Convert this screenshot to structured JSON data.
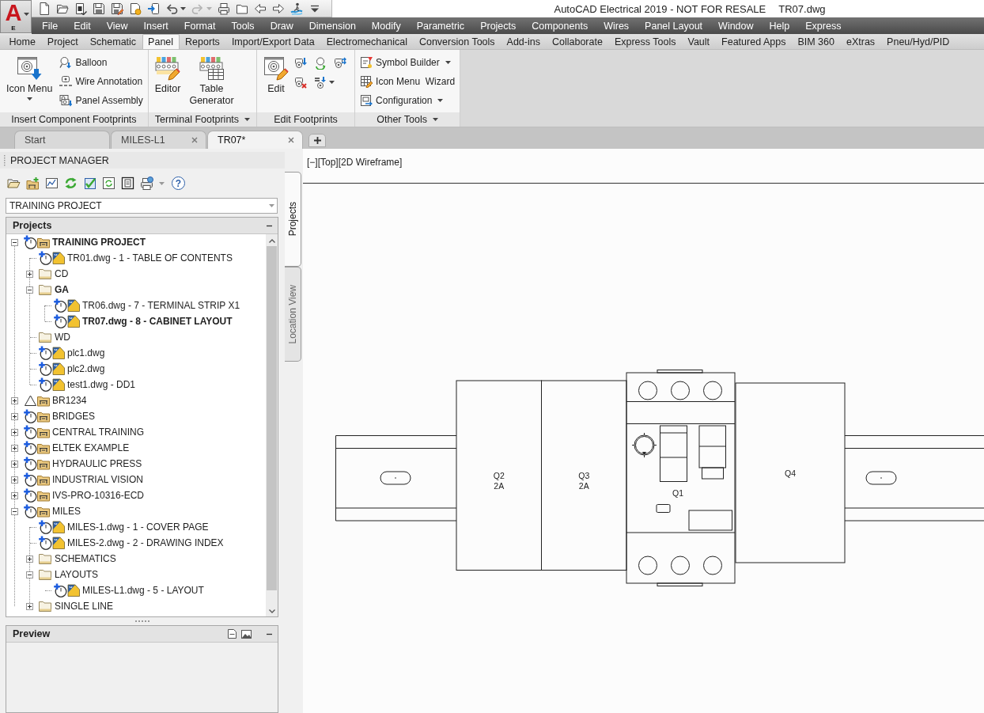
{
  "app_button": {
    "logo": "A",
    "subtitle": "E"
  },
  "quick_access_toolbar": [
    {
      "kind": "new",
      "disabled": false
    },
    {
      "kind": "open",
      "disabled": false
    },
    {
      "kind": "sheet",
      "disabled": false
    },
    {
      "kind": "save",
      "disabled": false
    },
    {
      "kind": "save-as",
      "disabled": false
    },
    {
      "kind": "publish",
      "disabled": false
    },
    {
      "kind": "import",
      "disabled": false
    },
    {
      "kind": "undo",
      "disabled": false
    },
    {
      "kind": "redo",
      "disabled": true
    },
    {
      "kind": "print",
      "disabled": false
    },
    {
      "kind": "folder",
      "disabled": false
    },
    {
      "kind": "back",
      "disabled": false
    },
    {
      "kind": "forward",
      "disabled": false
    },
    {
      "kind": "wave",
      "disabled": false
    },
    {
      "kind": "customize",
      "disabled": false
    }
  ],
  "title_bar": {
    "title": "AutoCAD Electrical 2019 - NOT FOR RESALE",
    "document": "TR07.dwg"
  },
  "menu_bar": [
    "File",
    "Edit",
    "View",
    "Insert",
    "Format",
    "Tools",
    "Draw",
    "Dimension",
    "Modify",
    "Parametric",
    "Projects",
    "Components",
    "Wires",
    "Panel Layout",
    "Window",
    "Help",
    "Express"
  ],
  "ribbon_tabs": [
    {
      "label": "Home",
      "selected": false
    },
    {
      "label": "Project",
      "selected": false
    },
    {
      "label": "Schematic",
      "selected": false
    },
    {
      "label": "Panel",
      "selected": true
    },
    {
      "label": "Reports",
      "selected": false
    },
    {
      "label": "Import/Export Data",
      "selected": false
    },
    {
      "label": "Electromechanical",
      "selected": false
    },
    {
      "label": "Conversion Tools",
      "selected": false
    },
    {
      "label": "Add-ins",
      "selected": false
    },
    {
      "label": "Collaborate",
      "selected": false
    },
    {
      "label": "Express Tools",
      "selected": false
    },
    {
      "label": "Vault",
      "selected": false
    },
    {
      "label": "Featured Apps",
      "selected": false
    },
    {
      "label": "BIM 360",
      "selected": false
    },
    {
      "label": "eXtras",
      "selected": false
    },
    {
      "label": "Pneu/Hyd/PID",
      "selected": false
    }
  ],
  "ribbon_panels": [
    {
      "title": "Insert Component Footprints",
      "dropdown": false,
      "large_tools": [
        {
          "kind": "icon-menu",
          "label": "Icon Menu",
          "dropdown": true
        }
      ],
      "small_tools": [
        {
          "kind": "balloon",
          "label": "Balloon",
          "dropdown": false
        },
        {
          "kind": "wire-annotation",
          "label": "Wire Annotation",
          "dropdown": false
        },
        {
          "kind": "panel-assembly",
          "label": "Panel Assembly",
          "dropdown": false
        }
      ]
    },
    {
      "title": "Terminal Footprints",
      "dropdown": true,
      "large_tools": [
        {
          "kind": "editor",
          "label": "Editor",
          "dropdown": false
        },
        {
          "kind": "table-generator",
          "label": "Table\nGenerator",
          "dropdown": false
        }
      ]
    },
    {
      "title": "Edit Footprints",
      "dropdown": false,
      "large_tools": [
        {
          "kind": "edit",
          "label": "Edit",
          "dropdown": false
        }
      ],
      "icon_tools": [
        {
          "kind": "footprint-arrow",
          "dropdown": false
        },
        {
          "kind": "retag",
          "dropdown": false
        },
        {
          "kind": "footprint-arrows",
          "dropdown": false
        },
        {
          "kind": "footprint-delete",
          "dropdown": false
        },
        {
          "kind": "resequence",
          "dropdown": true
        }
      ]
    },
    {
      "title": "Other Tools",
      "dropdown": true,
      "small_tools": [
        {
          "kind": "symbol-builder",
          "label": "Symbol Builder",
          "dropdown": true
        },
        {
          "kind": "icon-menu-wizard",
          "label": "Icon Menu  Wizard",
          "dropdown": false
        },
        {
          "kind": "configuration",
          "label": "Configuration",
          "dropdown": true
        }
      ]
    }
  ],
  "document_tabs": [
    {
      "label": "Start",
      "selected": false,
      "closable": false
    },
    {
      "label": "MILES-L1",
      "selected": false,
      "closable": true
    },
    {
      "label": "TR07*",
      "selected": true,
      "closable": true
    }
  ],
  "project_manager": {
    "title": "PROJECT MANAGER",
    "help_button": "?",
    "project_selector": {
      "value": "TRAINING PROJECT"
    },
    "projects_panel": {
      "title": "Projects",
      "tree": [
        {
          "kind": "project",
          "label": "TRAINING PROJECT",
          "active": true,
          "expanded": true,
          "children": [
            {
              "kind": "drawing",
              "label": "TR01.dwg - 1 - TABLE OF CONTENTS",
              "active": false
            },
            {
              "kind": "folder",
              "label": "CD",
              "active": false,
              "expanded": false
            },
            {
              "kind": "folder",
              "label": "GA",
              "active": true,
              "expanded": true,
              "children": [
                {
                  "kind": "drawing",
                  "label": "TR06.dwg - 7 - TERMINAL STRIP X1",
                  "active": false
                },
                {
                  "kind": "drawing",
                  "label": "TR07.dwg - 8 - CABINET LAYOUT",
                  "active": true
                }
              ]
            },
            {
              "kind": "folder",
              "label": "WD",
              "active": false
            },
            {
              "kind": "drawing",
              "label": "plc1.dwg",
              "active": false
            },
            {
              "kind": "drawing",
              "label": "plc2.dwg",
              "active": false
            },
            {
              "kind": "drawing",
              "label": "test1.dwg - DD1",
              "active": false
            }
          ]
        },
        {
          "kind": "project-alert",
          "label": "BR1234",
          "active": false,
          "expanded": false
        },
        {
          "kind": "project",
          "label": "BRIDGES",
          "active": false,
          "expanded": false
        },
        {
          "kind": "project",
          "label": "CENTRAL TRAINING",
          "active": false,
          "expanded": false
        },
        {
          "kind": "project",
          "label": "ELTEK EXAMPLE",
          "active": false,
          "expanded": false
        },
        {
          "kind": "project",
          "label": "HYDRAULIC PRESS",
          "active": false,
          "expanded": false
        },
        {
          "kind": "project",
          "label": "INDUSTRIAL VISION",
          "active": false,
          "expanded": false
        },
        {
          "kind": "project",
          "label": "IVS-PRO-10316-ECD",
          "active": false,
          "expanded": false
        },
        {
          "kind": "project",
          "label": "MILES",
          "active": false,
          "expanded": true,
          "children": [
            {
              "kind": "drawing",
              "label": "MILES-1.dwg - 1 - COVER PAGE",
              "active": false
            },
            {
              "kind": "drawing",
              "label": "MILES-2.dwg - 2 - DRAWING INDEX",
              "active": false
            },
            {
              "kind": "folder",
              "label": "SCHEMATICS",
              "active": false,
              "expanded": false
            },
            {
              "kind": "folder",
              "label": "LAYOUTS",
              "active": false,
              "expanded": true,
              "children": [
                {
                  "kind": "drawing",
                  "label": "MILES-L1.dwg - 5 - LAYOUT",
                  "active": false
                }
              ]
            },
            {
              "kind": "folder",
              "label": "SINGLE LINE",
              "active": false,
              "expanded": false
            }
          ]
        }
      ]
    },
    "preview_panel": {
      "title": "Preview"
    }
  },
  "side_tabs": [
    {
      "label": "Projects",
      "selected": true
    },
    {
      "label": "Location View",
      "selected": false
    }
  ],
  "viewport": {
    "label": "[−][Top][2D Wireframe]",
    "components": [
      {
        "kind": "module",
        "tag": "Q2",
        "rating": "2A"
      },
      {
        "kind": "module",
        "tag": "Q3",
        "rating": "2A"
      },
      {
        "kind": "motor-protector",
        "tag": "Q1"
      },
      {
        "kind": "block",
        "tag": "Q4"
      }
    ]
  }
}
